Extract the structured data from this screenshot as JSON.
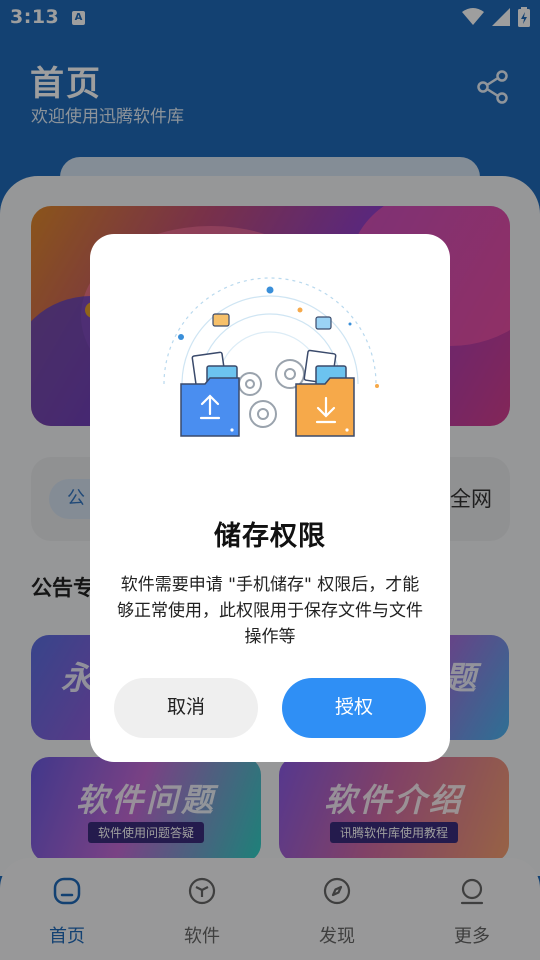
{
  "status_bar": {
    "time": "3:13",
    "notification_letter": "A"
  },
  "header": {
    "title": "首页",
    "subtitle": "欢迎使用迅腾软件库"
  },
  "notice": {
    "pill_label": "公",
    "text": "全网"
  },
  "section": {
    "title": "公告专"
  },
  "tiles": [
    {
      "title": "永",
      "subtitle": ""
    },
    {
      "title": "题",
      "subtitle": ""
    },
    {
      "title": "软件问题",
      "subtitle": "软件使用问题答疑"
    },
    {
      "title": "软件介绍",
      "subtitle": "讯腾软件库使用教程"
    }
  ],
  "nav": {
    "items": [
      {
        "label": "首页",
        "icon": "home-icon",
        "active": true
      },
      {
        "label": "软件",
        "icon": "cube-icon",
        "active": false
      },
      {
        "label": "发现",
        "icon": "compass-icon",
        "active": false
      },
      {
        "label": "更多",
        "icon": "user-icon",
        "active": false
      }
    ]
  },
  "dialog": {
    "title": "储存权限",
    "message": "软件需要申请 \"手机储存\" 权限后，才能够正常使用，此权限用于保存文件与文件操作等",
    "cancel_label": "取消",
    "confirm_label": "授权"
  },
  "colors": {
    "primary": "#1f6ab8",
    "confirm_button": "#2f8ff5",
    "cancel_button": "#efefef",
    "folder_upload": "#4a8ef0",
    "folder_download": "#f6a94a"
  }
}
